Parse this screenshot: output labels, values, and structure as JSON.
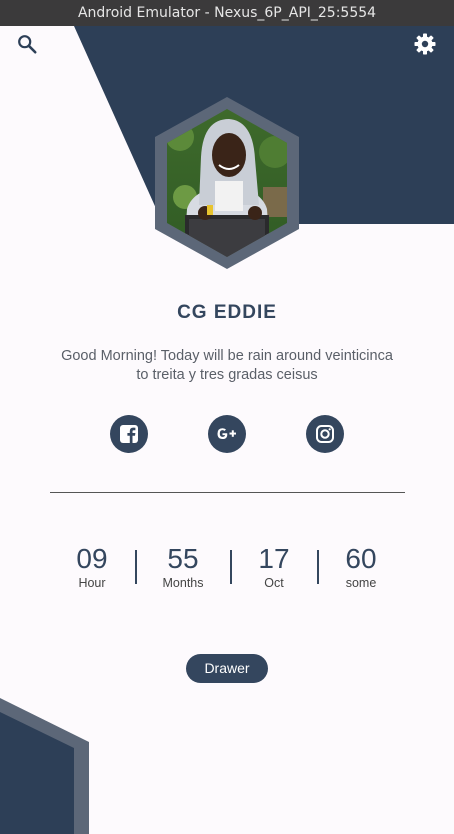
{
  "window": {
    "title": "Android Emulator - Nexus_6P_API_25:5554"
  },
  "colors": {
    "primary": "#34465e",
    "frame": "#5c6778",
    "background": "#fdfafd"
  },
  "header": {
    "search_icon": "search-icon",
    "settings_icon": "gear-icon"
  },
  "profile": {
    "name": "CG EDDIE",
    "greeting": "Good Morning! Today will be rain around veinticinca to treita y tres gradas ceisus"
  },
  "social": {
    "icons": [
      "facebook-icon",
      "google-plus-icon",
      "instagram-icon"
    ]
  },
  "stats": [
    {
      "value": "09",
      "label": "Hour"
    },
    {
      "value": "55",
      "label": "Months"
    },
    {
      "value": "17",
      "label": "Oct"
    },
    {
      "value": "60",
      "label": "some"
    }
  ],
  "actions": {
    "drawer_label": "Drawer"
  }
}
